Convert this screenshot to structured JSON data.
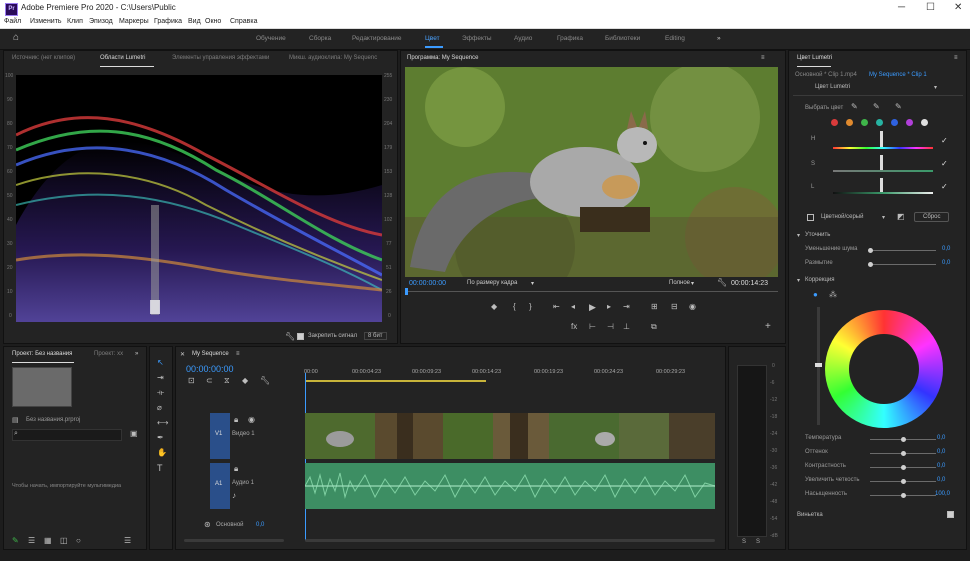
{
  "app": {
    "title": "Adobe Premiere Pro 2020 - C:\\Users\\Public",
    "icon_label": "Pr"
  },
  "menu": [
    "Файл",
    "Изменить",
    "Клип",
    "Эпизод",
    "Маркеры",
    "Графика",
    "Вид",
    "Окно",
    "Справка"
  ],
  "workspaces": [
    {
      "label": "Обучение"
    },
    {
      "label": "Сборка"
    },
    {
      "label": "Редактирование"
    },
    {
      "label": "Цвет"
    },
    {
      "label": "Эффекты"
    },
    {
      "label": "Аудио"
    },
    {
      "label": "Графика"
    },
    {
      "label": "Библиотеки"
    },
    {
      "label": "Editing"
    }
  ],
  "source_panel": {
    "tabs": [
      "Источник: (нет клипов)",
      "Области Lumetri",
      "Элементы управления эффектами",
      "Микш. аудиоклипа: My Sequenc"
    ],
    "scale_right": [
      "255",
      "230",
      "204",
      "179",
      "153",
      "128",
      "102",
      "77",
      "51",
      "26",
      "0"
    ],
    "scale_left": [
      "100",
      "90",
      "80",
      "70",
      "60",
      "50",
      "40",
      "30",
      "20",
      "10",
      "0"
    ],
    "clamp_label": "Закрепить сигнал",
    "bit_depth": "8 бит"
  },
  "program_panel": {
    "title": "Программа: My Sequence",
    "timecode": "00:00:00:00",
    "zoom": "По размеру кадра",
    "quality": "Полное",
    "duration": "00:00:14:23"
  },
  "lumetri_panel": {
    "title": "Цвет Lumetri",
    "breadcrumb_left": "Основной * Clip 1.mp4",
    "breadcrumb_right": "My Sequence * Clip 1",
    "preset": "Цвет Lumetri",
    "select_color_label": "Выбрать цвет",
    "hsl_labels": [
      "H",
      "S",
      "L"
    ],
    "colorswatch": [
      "#d93b3b",
      "#e08a2e",
      "#3fb54a",
      "#27b3a2",
      "#2f62e0",
      "#b13fd9",
      "#e0e0e0"
    ],
    "bw_label": "Цветной/серый",
    "reset_label": "Сброс",
    "refine_label": "Уточнить",
    "refine_rows": [
      {
        "label": "Уменьшение шума",
        "value": "0,0",
        "level": 0
      },
      {
        "label": "Размытие",
        "value": "0,0",
        "level": 0
      }
    ],
    "correction_label": "Коррекция",
    "correction_rows": [
      {
        "label": "Температура",
        "value": "0,0",
        "level": 0.5
      },
      {
        "label": "Оттенок",
        "value": "0,0",
        "level": 0.5
      },
      {
        "label": "Контрастность",
        "value": "0,0",
        "level": 0.5
      },
      {
        "label": "Увеличить четкость",
        "value": "0,0",
        "level": 0.5
      },
      {
        "label": "Насыщенность",
        "value": "100,0",
        "level": 0.5
      }
    ],
    "mask_label": "Виньетка"
  },
  "project_panel": {
    "tabs": [
      "Проект: Без названия",
      "Проект: хх"
    ],
    "file_name": "Без названия.prproj",
    "hint": "Чтобы начать, импортируйте мультимедиа"
  },
  "timeline_panel": {
    "title": "My Sequence",
    "timecode": "00:00:00:00",
    "ruler": [
      "00:00",
      "00:00:04:23",
      "00:00:09:23",
      "00:00:14:23",
      "00:00:19:23",
      "00:00:24:23",
      "00:00:29:23"
    ],
    "tracks": [
      {
        "id": "V1",
        "name": "Видео 1"
      },
      {
        "id": "A1",
        "name": "Аудио 1"
      }
    ],
    "master_label": "Основной",
    "master_value": "0,0"
  },
  "audio_meter": {
    "scale": [
      "0",
      "-6",
      "-12",
      "-18",
      "-24",
      "-30",
      "-36",
      "-42",
      "-48",
      "-54",
      "-dB"
    ],
    "bottom": [
      "S",
      "S"
    ]
  },
  "colors": {
    "accent": "#3b9bff",
    "background": "#1d1d1d",
    "panel": "#232323",
    "video_track": "#2a4f8a",
    "audio_track": "#3d8e63"
  }
}
